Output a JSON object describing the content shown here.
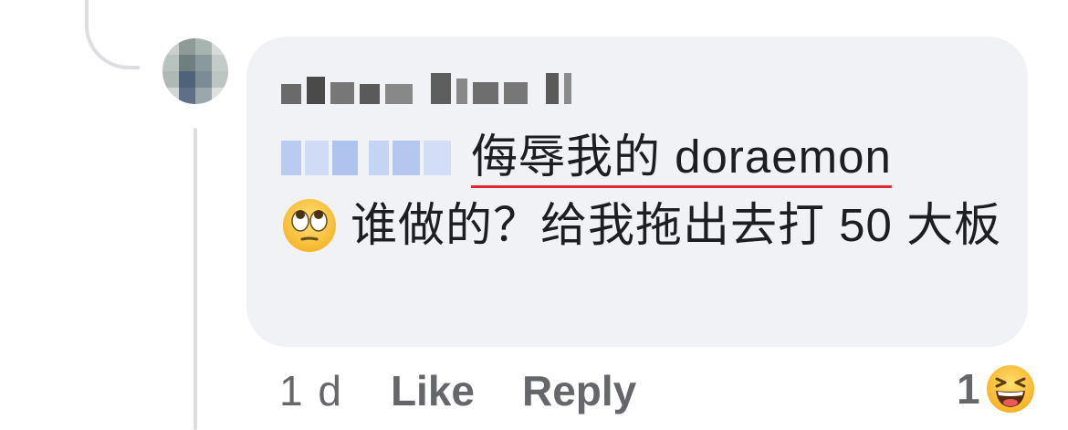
{
  "comment": {
    "author": "",
    "text_underlined": "侮辱我的 doraemon",
    "text_rest": "谁做的？给我拖出去打 50 大板",
    "emoji": "face-with-rolling-eyes-icon"
  },
  "actions": {
    "timestamp": "1 d",
    "like_label": "Like",
    "reply_label": "Reply"
  },
  "reactions": {
    "count": "1",
    "icon": "laughing-face-icon"
  },
  "colors": {
    "bubble": "#f0f2f5",
    "thread_line": "#dcdee2",
    "muted_text": "#65676b",
    "spellcheck_underline": "#e0282e",
    "mention_blur": "#c8d6f3"
  }
}
